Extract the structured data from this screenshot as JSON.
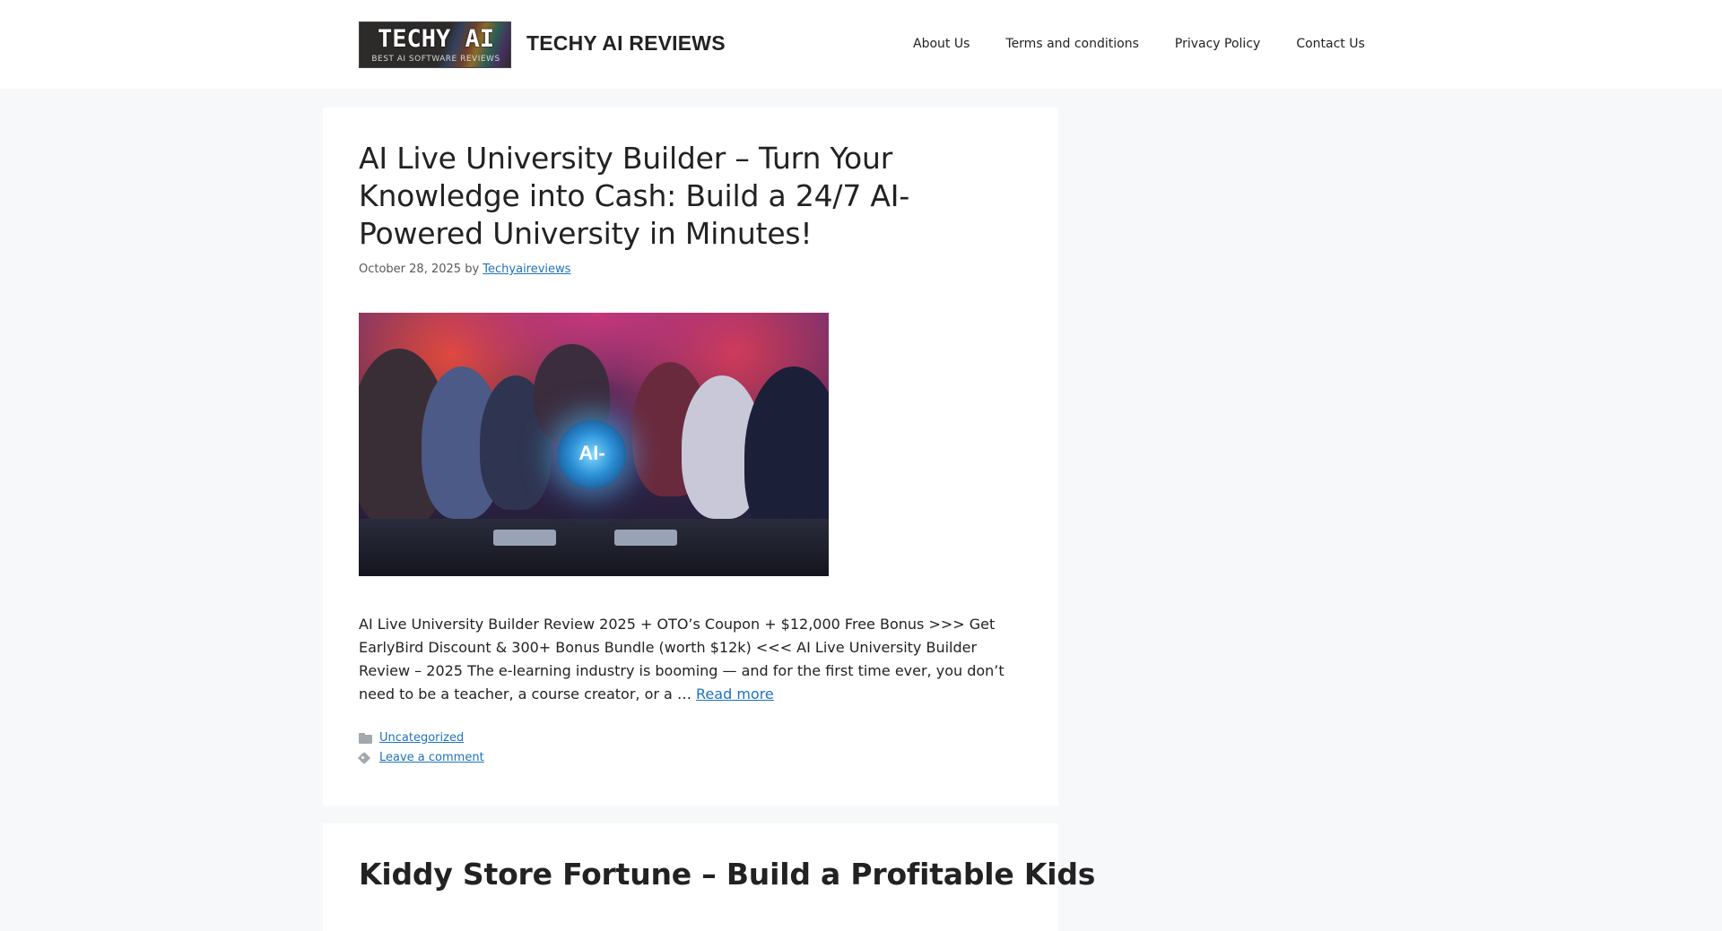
{
  "header": {
    "logo_text": "TECHY AI",
    "logo_sub": "BEST AI SOFTWARE REVIEWS",
    "site_title": "TECHY AI REVIEWS",
    "nav": [
      {
        "label": "About Us"
      },
      {
        "label": "Terms and conditions"
      },
      {
        "label": "Privacy Policy"
      },
      {
        "label": "Contact Us"
      }
    ]
  },
  "posts": [
    {
      "title": "AI Live University Builder – Turn Your Knowledge into Cash: Build a 24/7 AI-Powered University in Minutes!",
      "date": "October 28, 2025",
      "by": "by",
      "author": "Techyaireviews",
      "image_label": "AI-",
      "excerpt": "AI Live University Builder Review 2025 + OTO’s Coupon + $12,000 Free Bonus >>> Get EarlyBird Discount & 300+ Bonus Bundle (worth $12k) <<< AI Live University Builder Review – 2025 The e-learning industry is booming — and for the first time ever, you don’t need to be a teacher, a course creator, or a …",
      "read_more": "Read more",
      "category": "Uncategorized",
      "comment_link": "Leave a comment"
    },
    {
      "title": "Kiddy Store Fortune – Build a Profitable Kids"
    }
  ],
  "colors": {
    "link": "#1e73be",
    "page_bg": "#f7f8f9",
    "card_bg": "#ffffff",
    "text": "#222222"
  },
  "icons": [
    "folder-icon",
    "tags-icon"
  ]
}
